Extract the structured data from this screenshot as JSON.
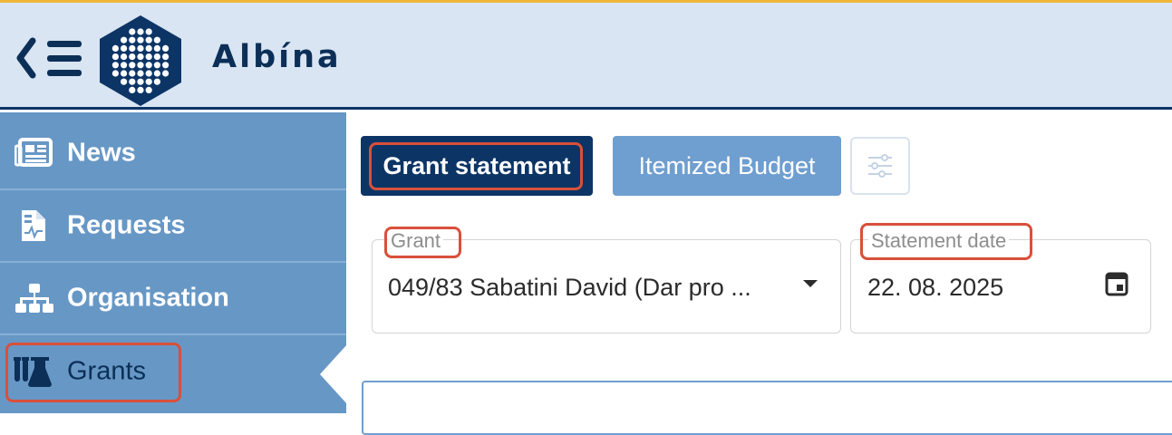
{
  "header": {
    "brand": "Albína",
    "colors": {
      "background": "#d9e5f3",
      "accent": "#0c3566",
      "top_strip": "#f0b63a"
    }
  },
  "sidebar": {
    "items": [
      {
        "label": "News",
        "icon": "newspaper-icon"
      },
      {
        "label": "Requests",
        "icon": "file-medical-icon"
      },
      {
        "label": "Organisation",
        "icon": "sitemap-icon"
      },
      {
        "label": "Grants",
        "icon": "flask-vial-icon",
        "active": true
      }
    ]
  },
  "tabs": {
    "grant_statement": "Grant statement",
    "itemized_budget": "Itemized Budget",
    "settings_icon": "sliders-icon"
  },
  "form": {
    "grant": {
      "label": "Grant",
      "value": "049/83 Sabatini David (Dar pro ..."
    },
    "statement_date": {
      "label": "Statement date",
      "value": "22. 08. 2025"
    }
  }
}
